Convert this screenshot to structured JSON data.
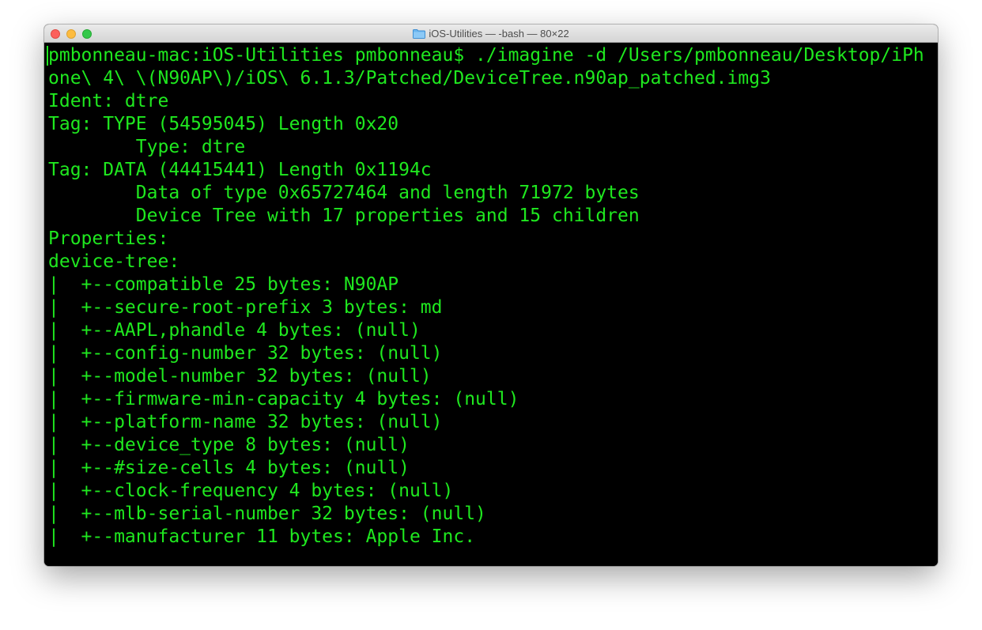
{
  "window": {
    "title": "iOS-Utilities — -bash — 80×22",
    "icon": "folder-icon"
  },
  "terminal": {
    "text_color": "#1fe81f",
    "background": "#000000",
    "lines": [
      "pmbonneau-mac:iOS-Utilities pmbonneau$ ./imagine -d /Users/pmbonneau/Desktop/iPh",
      "one\\ 4\\ \\(N90AP\\)/iOS\\ 6.1.3/Patched/DeviceTree.n90ap_patched.img3",
      "Ident: dtre",
      "Tag: TYPE (54595045) Length 0x20",
      "        Type: dtre",
      "Tag: DATA (44415441) Length 0x1194c",
      "        Data of type 0x65727464 and length 71972 bytes",
      "        Device Tree with 17 properties and 15 children",
      "Properties:",
      "device-tree:",
      "|  +--compatible 25 bytes: N90AP",
      "|  +--secure-root-prefix 3 bytes: md",
      "|  +--AAPL,phandle 4 bytes: (null)",
      "|  +--config-number 32 bytes: (null)",
      "|  +--model-number 32 bytes: (null)",
      "|  +--firmware-min-capacity 4 bytes: (null)",
      "|  +--platform-name 32 bytes: (null)",
      "|  +--device_type 8 bytes: (null)",
      "|  +--#size-cells 4 bytes: (null)",
      "|  +--clock-frequency 4 bytes: (null)",
      "|  +--mlb-serial-number 32 bytes: (null)",
      "|  +--manufacturer 11 bytes: Apple Inc."
    ]
  }
}
